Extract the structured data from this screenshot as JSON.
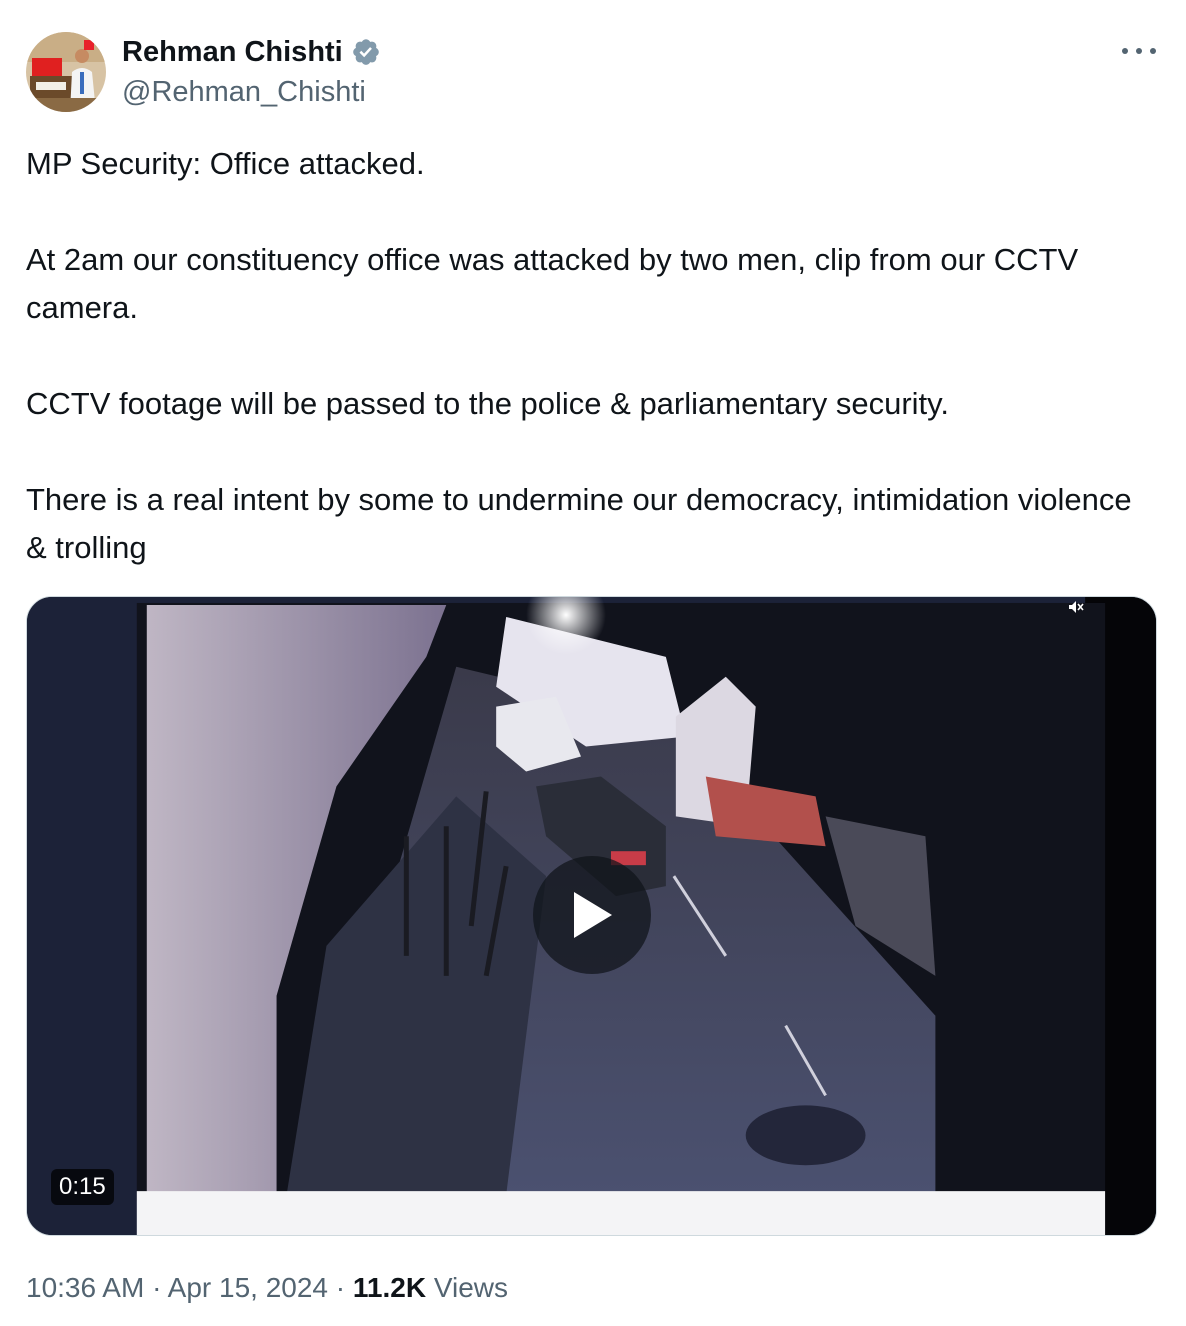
{
  "author": {
    "display_name": "Rehman Chishti",
    "handle": "@Rehman_Chishti",
    "verified_icon": "verified-badge-icon",
    "verified_color": "#829aab"
  },
  "menu": {
    "icon": "more-horizontal-icon"
  },
  "tweet": {
    "paragraphs": [
      "MP Security: Office attacked.",
      "At 2am our constituency office was attacked by two men, clip  from our CCTV camera.",
      "CCTV footage will be passed to the police & parliamentary security.",
      "There is a real intent by some to undermine our democracy, intimidation violence & trolling"
    ]
  },
  "media": {
    "type": "video",
    "duration": "0:15",
    "play_icon": "play-icon",
    "mute_icon": "muted-speaker-icon"
  },
  "meta": {
    "time": "10:36 AM",
    "separator": "·",
    "date": "Apr 15, 2024",
    "views_count": "11.2K",
    "views_label": "Views"
  },
  "colors": {
    "text_primary": "#0f1419",
    "text_secondary": "#536471",
    "border": "#cfd9de"
  }
}
